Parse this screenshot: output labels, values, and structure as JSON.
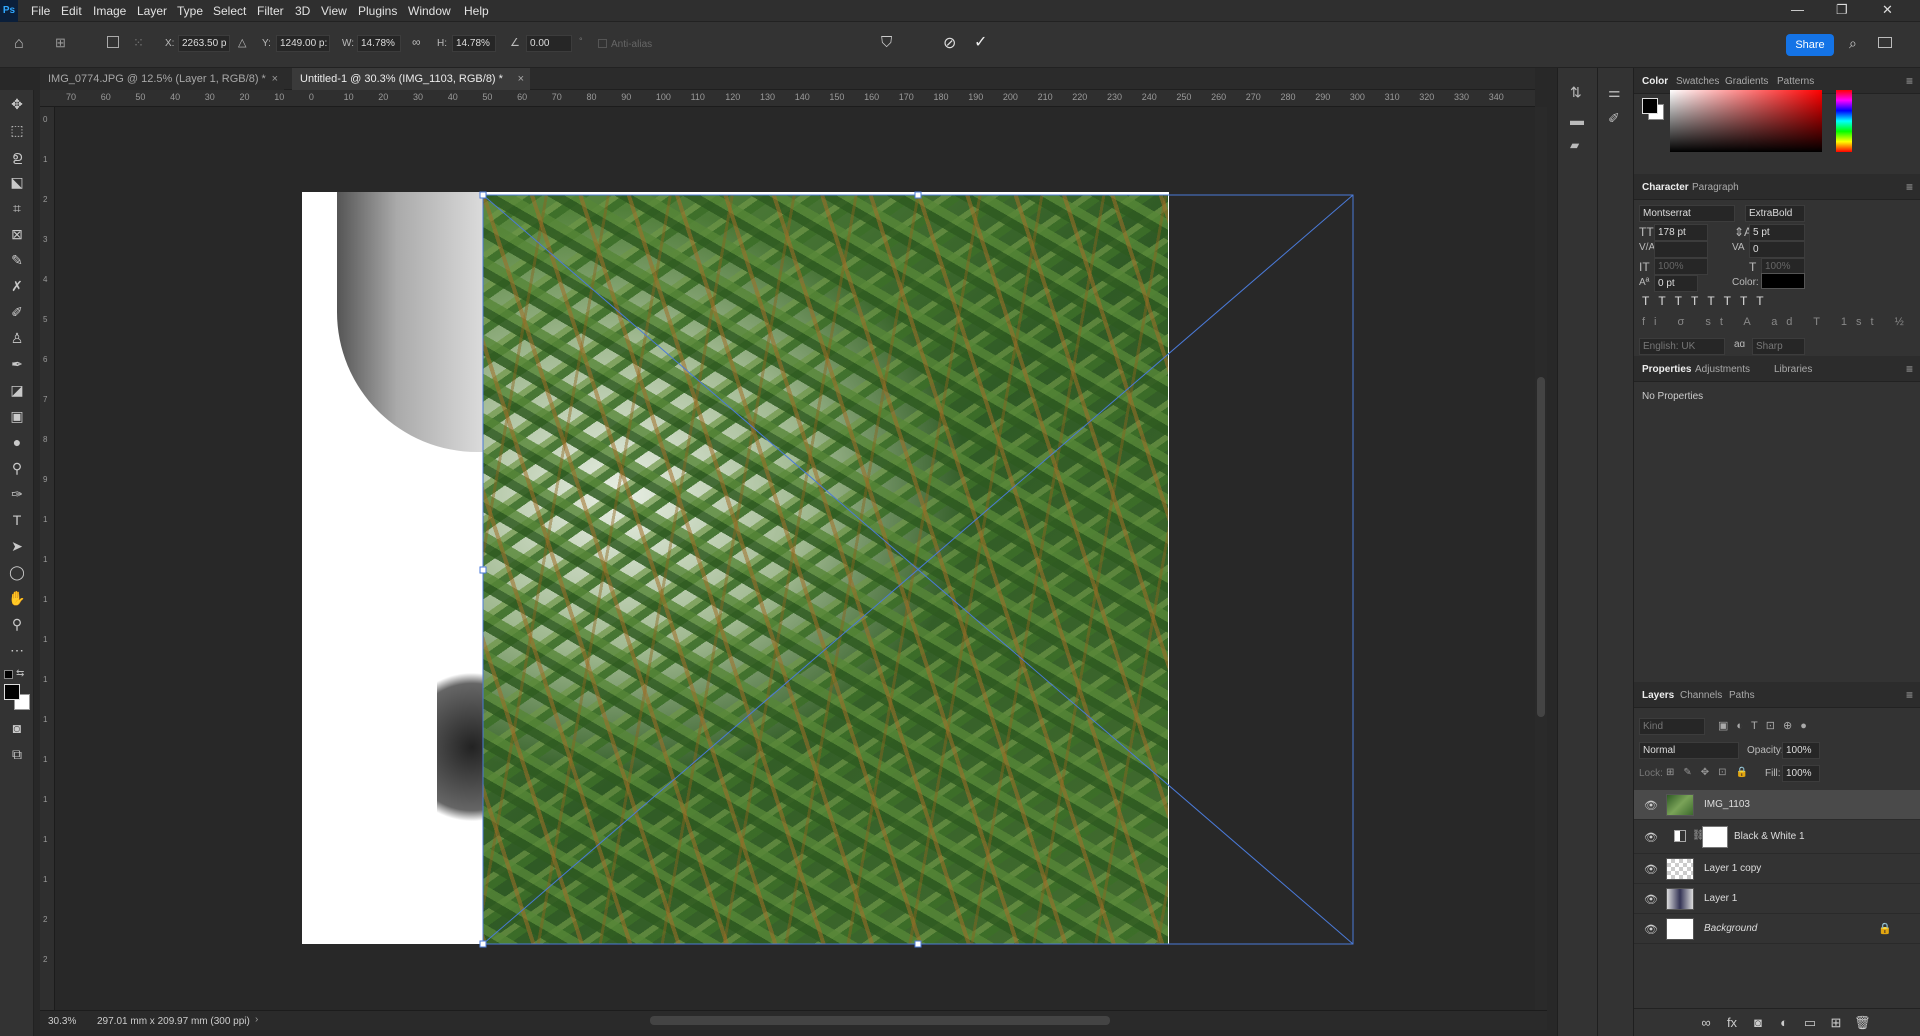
{
  "app": {
    "logo": "Ps"
  },
  "menu": [
    "File",
    "Edit",
    "Image",
    "Layer",
    "Type",
    "Select",
    "Filter",
    "3D",
    "View",
    "Plugins",
    "Window",
    "Help"
  ],
  "window_controls": {
    "minimize": "—",
    "restore": "❐",
    "close": "✕"
  },
  "options_bar": {
    "x_label": "X:",
    "x_value": "2263.50 p",
    "y_label": "Y:",
    "y_value": "1249.00 p:",
    "w_label": "W:",
    "w_value": "14.78%",
    "h_label": "H:",
    "h_value": "14.78%",
    "angle_value": "0.00",
    "antialias_label": "Anti-alias",
    "share_label": "Share"
  },
  "doc_tabs": [
    {
      "title": "IMG_0774.JPG @ 12.5% (Layer 1, RGB/8) *",
      "active": false
    },
    {
      "title": "Untitled-1 @ 30.3% (IMG_1103, RGB/8) *",
      "active": true
    }
  ],
  "ruler_top": [
    "70",
    "60",
    "50",
    "40",
    "30",
    "20",
    "10",
    "0",
    "10",
    "20",
    "30",
    "40",
    "50",
    "60",
    "70",
    "80",
    "90",
    "100",
    "110",
    "120",
    "130",
    "140",
    "150",
    "160",
    "170",
    "180",
    "190",
    "200",
    "210",
    "220",
    "230",
    "240",
    "250",
    "260",
    "270",
    "280",
    "290",
    "300",
    "310",
    "320",
    "330",
    "340"
  ],
  "ruler_left": [
    "0",
    "1",
    "2",
    "3",
    "4",
    "5",
    "6",
    "7",
    "8",
    "9",
    "1",
    "1",
    "1",
    "1",
    "1",
    "1",
    "1",
    "1",
    "1",
    "1",
    "2",
    "2"
  ],
  "status": {
    "zoom": "30.3%",
    "doc_info": "297.01 mm x 209.97 mm (300 ppi)"
  },
  "color_panel": {
    "tabs": [
      "Color",
      "Swatches",
      "Gradients",
      "Patterns"
    ],
    "foreground": "#000000",
    "background": "#ffffff",
    "hue": "#ff0000"
  },
  "character_panel": {
    "tabs": [
      "Character",
      "Paragraph"
    ],
    "font_family": "Montserrat",
    "font_style": "ExtraBold",
    "font_size": "178 pt",
    "leading": "5 pt",
    "kerning": "",
    "tracking": "0",
    "vscale": "100%",
    "hscale": "100%",
    "baseline": "0 pt",
    "color_label": "Color:",
    "text_color": "#000000",
    "language": "English: UK",
    "aa_label": "aɑ",
    "antialias": "Sharp"
  },
  "properties_panel": {
    "tabs": [
      "Properties",
      "Adjustments",
      "Libraries"
    ],
    "body": "No Properties"
  },
  "layers_panel": {
    "tabs": [
      "Layers",
      "Channels",
      "Paths"
    ],
    "filter_placeholder": "Kind",
    "blend_mode": "Normal",
    "opacity_label": "Opacity:",
    "opacity": "100%",
    "lock_label": "Lock:",
    "fill_label": "Fill:",
    "fill": "100%",
    "layers": [
      {
        "name": "IMG_1103",
        "selected": true
      },
      {
        "name": "Black & White 1",
        "selected": false
      },
      {
        "name": "Layer 1 copy",
        "selected": false
      },
      {
        "name": "Layer 1",
        "selected": false
      },
      {
        "name": "Background",
        "selected": false,
        "italic": true,
        "locked": true
      }
    ]
  }
}
